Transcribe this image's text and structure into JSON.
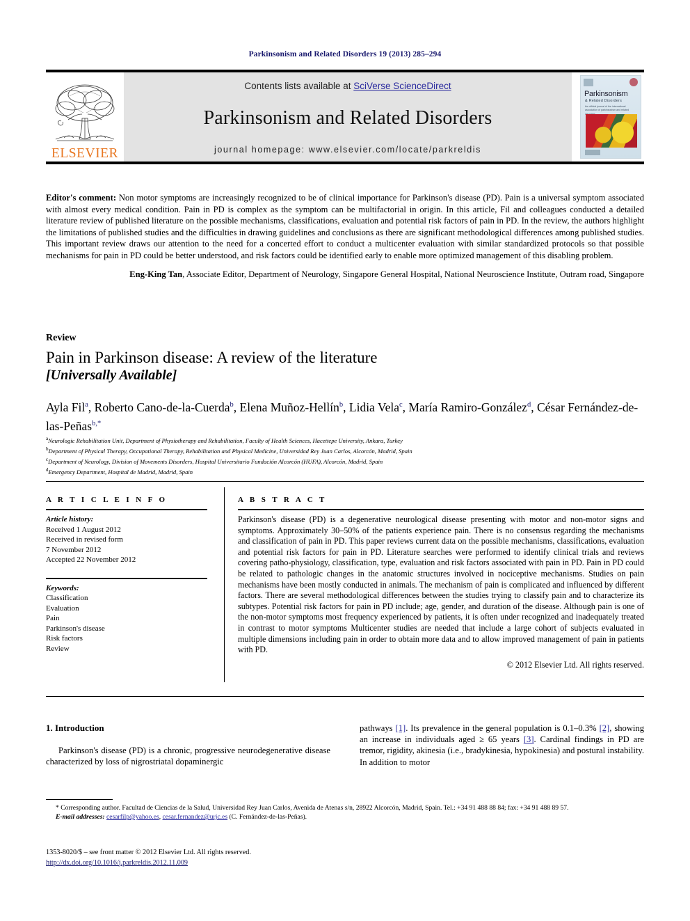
{
  "running_head": "Parkinsonism and Related Disorders 19 (2013) 285–294",
  "masthead": {
    "contents_prefix": "Contents lists available at ",
    "sciencedirect_link": "SciVerse ScienceDirect",
    "journal_title": "Parkinsonism and Related Disorders",
    "homepage_line": "journal homepage: www.elsevier.com/locate/parkreldis",
    "publisher_name": "ELSEVIER",
    "cover": {
      "title": "Parkinsonism",
      "subtitle": "& Related Disorders",
      "caption": "the official journal of the international association\nof parkinsonism and related disorders"
    }
  },
  "editor_comment": {
    "label": "Editor's comment:",
    "text": " Non motor symptoms are increasingly recognized to be of clinical importance for Parkinson's disease (PD). Pain is a universal symptom associated with almost every medical condition. Pain in PD is complex as the symptom can be multifactorial in origin. In this article, Fil and colleagues conducted a detailed literature review of published literature on the possible mechanisms, classifications, evaluation and potential risk factors of pain in PD. In the review, the authors highlight the limitations of published studies and the difficulties in drawing guidelines and conclusions as there are significant methodological differences among published studies. This important review draws our attention to the need for a concerted effort to conduct a multicenter evaluation with similar standardized protocols so that possible mechanisms for pain in PD could be better understood, and risk factors could be identified early to enable more optimized management of this disabling problem.",
    "signature_name": "Eng-King Tan",
    "signature_rest": ", Associate Editor, Department of Neurology, Singapore General Hospital, National Neuroscience Institute, Outram road, Singapore"
  },
  "article_type": "Review",
  "title": "Pain in Parkinson disease: A review of the literature",
  "subtitle": "[Universally Available]",
  "authors": [
    {
      "name": "Ayla Fil",
      "marks": "a",
      "sep": ", "
    },
    {
      "name": "Roberto Cano-de-la-Cuerda",
      "marks": "b",
      "sep": ", "
    },
    {
      "name": "Elena Muñoz-Hellín",
      "marks": "b",
      "sep": ", "
    },
    {
      "name": "Lidia Vela",
      "marks": "c",
      "sep": ", "
    },
    {
      "name": "María Ramiro-González",
      "marks": "d",
      "sep": ", "
    },
    {
      "name": "César Fernández-de-las-Peñas",
      "marks": "b,*",
      "sep": ""
    }
  ],
  "affiliations": [
    {
      "mark": "a",
      "text": "Neurologic Rehabilitation Unit, Department of Physiotherapy and Rehabilitation, Faculty of Health Sciences, Hacettepe University, Ankara, Turkey"
    },
    {
      "mark": "b",
      "text": "Department of Physical Therapy, Occupational Therapy, Rehabilitation and Physical Medicine, Universidad Rey Juan Carlos, Alcorcón, Madrid, Spain"
    },
    {
      "mark": "c",
      "text": "Department of Neurology, Division of Movements Disorders, Hospital Universitario Fundación Alcorcón (HUFA), Alcorcón, Madrid, Spain"
    },
    {
      "mark": "d",
      "text": "Emergency Department, Hospital de Madrid, Madrid, Spain"
    }
  ],
  "article_info": {
    "heading": "A R T I C L E  I N F O",
    "history_label": "Article history:",
    "history_lines": [
      "Received 1 August 2012",
      "Received in revised form",
      "7 November 2012",
      "Accepted 22 November 2012"
    ],
    "keywords_label": "Keywords:",
    "keywords": [
      "Classification",
      "Evaluation",
      "Pain",
      "Parkinson's disease",
      "Risk factors",
      "Review"
    ]
  },
  "abstract": {
    "heading": "A B S T R A C T",
    "text": "Parkinson's disease (PD) is a degenerative neurological disease presenting with motor and non-motor signs and symptoms. Approximately 30–50% of the patients experience pain. There is no consensus regarding the mechanisms and classification of pain in PD. This paper reviews current data on the possible mechanisms, classifications, evaluation and potential risk factors for pain in PD. Literature searches were performed to identify clinical trials and reviews covering patho-physiology, classification, type, evaluation and risk factors associated with pain in PD. Pain in PD could be related to pathologic changes in the anatomic structures involved in nociceptive mechanisms. Studies on pain mechanisms have been mostly conducted in animals. The mechanism of pain is complicated and influenced by different factors. There are several methodological differences between the studies trying to classify pain and to characterize its subtypes. Potential risk factors for pain in PD include; age, gender, and duration of the disease. Although pain is one of the non-motor symptoms most frequency experienced by patients, it is often under recognized and inadequately treated in contrast to motor symptoms Multicenter studies are needed that include a large cohort of subjects evaluated in multiple dimensions including pain in order to obtain more data and to allow improved management of pain in patients with PD.",
    "rights": "© 2012 Elsevier Ltd. All rights reserved."
  },
  "body": {
    "section_heading": "1. Introduction",
    "left_paragraph": "Parkinson's disease (PD) is a chronic, progressive neurodegenerative disease characterized by loss of nigrostriatal dopaminergic",
    "right_paragraph_parts": [
      {
        "t": "pathways "
      },
      {
        "t": "[1]",
        "ref": true
      },
      {
        "t": ". Its prevalence in the general population is 0.1–0.3% "
      },
      {
        "t": "[2]",
        "ref": true
      },
      {
        "t": ", showing an increase in individuals aged ≥ 65 years "
      },
      {
        "t": "[3]",
        "ref": true
      },
      {
        "t": ". Cardinal findings in PD are tremor, rigidity, akinesia (i.e., bradykinesia, hypokinesia) and postural instability. In addition to motor"
      }
    ]
  },
  "footnote": {
    "corresponding": "* Corresponding author. Facultad de Ciencias de la Salud, Universidad Rey Juan Carlos, Avenida de Atenas s/n, 28922 Alcorcón, Madrid, Spain. Tel.: +34 91 488 88 84; fax: +34 91 488 89 57.",
    "email_label": "E-mail addresses:",
    "email1": "cesarfilp@yahoo.es",
    "email_sep": ", ",
    "email2": "cesar.fernandez@urjc.es",
    "email_tail": " (C. Fernández-de-las-Peñas)."
  },
  "issn_line": "1353-8020/$ – see front matter © 2012 Elsevier Ltd. All rights reserved.",
  "doi_line": "http://dx.doi.org/10.1016/j.parkreldis.2012.11.009",
  "colors": {
    "link_blue": "#2a2a9e",
    "dark_blue": "#1a1a6e",
    "elsevier_orange": "#E87722",
    "masthead_grey": "#e3e3e3"
  }
}
